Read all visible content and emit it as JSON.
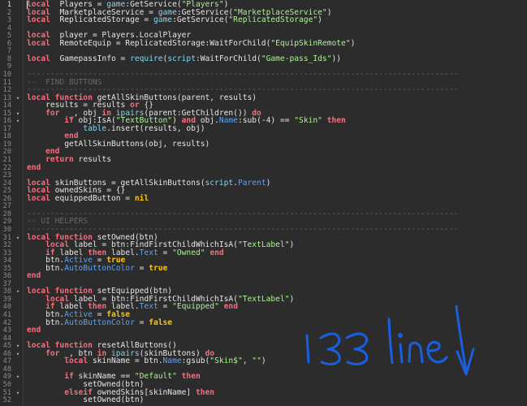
{
  "annotation": {
    "text": "133 line",
    "color": "#1a5fe0"
  },
  "lines": [
    {
      "n": "1",
      "fold": "",
      "spans": [
        [
          "kw",
          "local"
        ],
        [
          "",
          "  Players = "
        ],
        [
          "bi",
          "game"
        ],
        [
          "",
          ":GetService("
        ],
        [
          "str",
          "\"Players\""
        ],
        [
          "",
          ")"
        ]
      ]
    },
    {
      "n": "2",
      "fold": "",
      "spans": [
        [
          "kw",
          "local"
        ],
        [
          "",
          "  MarketplaceService = "
        ],
        [
          "bi",
          "game"
        ],
        [
          "",
          ":GetService("
        ],
        [
          "str",
          "\"MarketplaceService\""
        ],
        [
          "",
          ")"
        ]
      ]
    },
    {
      "n": "3",
      "fold": "",
      "spans": [
        [
          "kw",
          "local"
        ],
        [
          "",
          "  ReplicatedStorage = "
        ],
        [
          "bi",
          "game"
        ],
        [
          "",
          ":GetService("
        ],
        [
          "str",
          "\"ReplicatedStorage\""
        ],
        [
          "",
          ")"
        ]
      ]
    },
    {
      "n": "4",
      "fold": "",
      "spans": []
    },
    {
      "n": "5",
      "fold": "",
      "spans": [
        [
          "kw",
          "local"
        ],
        [
          "",
          "  player = Players.LocalPlayer"
        ]
      ]
    },
    {
      "n": "6",
      "fold": "",
      "spans": [
        [
          "kw",
          "local"
        ],
        [
          "",
          "  RemoteEquip = ReplicatedStorage:WaitForChild("
        ],
        [
          "str",
          "\"EquipSkinRemote\""
        ],
        [
          "",
          ")"
        ]
      ]
    },
    {
      "n": "7",
      "fold": "",
      "spans": []
    },
    {
      "n": "8",
      "fold": "",
      "spans": [
        [
          "kw",
          "local"
        ],
        [
          "",
          "  GamepassInfo = "
        ],
        [
          "bi",
          "require"
        ],
        [
          "",
          "("
        ],
        [
          "bi",
          "script"
        ],
        [
          "",
          ":WaitForChild("
        ],
        [
          "str",
          "\"Game-pass_Ids\""
        ],
        [
          "",
          "))"
        ]
      ]
    },
    {
      "n": "9",
      "fold": "",
      "spans": []
    },
    {
      "n": "10",
      "fold": "",
      "spans": [
        [
          "cm",
          "--------------------------------------------------------------------------------------------"
        ]
      ]
    },
    {
      "n": "11",
      "fold": "",
      "spans": [
        [
          "cm",
          "--  FIND BUTTONS"
        ]
      ]
    },
    {
      "n": "12",
      "fold": "",
      "spans": [
        [
          "cm",
          "--------------------------------------------------------------------------------------------"
        ]
      ]
    },
    {
      "n": "13",
      "fold": "v",
      "spans": [
        [
          "kw",
          "local function"
        ],
        [
          "",
          " getAllSkinButtons(parent, results)"
        ]
      ]
    },
    {
      "n": "14",
      "fold": "",
      "spans": [
        [
          "",
          "    results = results "
        ],
        [
          "kw",
          "or"
        ],
        [
          "",
          " {}"
        ]
      ]
    },
    {
      "n": "15",
      "fold": "v",
      "spans": [
        [
          "",
          "    "
        ],
        [
          "kw",
          "for"
        ],
        [
          "",
          "  _, obj "
        ],
        [
          "kw",
          "in"
        ],
        [
          "",
          " "
        ],
        [
          "bi",
          "ipairs"
        ],
        [
          "",
          "(parent:GetChildren()) "
        ],
        [
          "kw",
          "do"
        ]
      ]
    },
    {
      "n": "16",
      "fold": "v",
      "spans": [
        [
          "",
          "        "
        ],
        [
          "kw",
          "if"
        ],
        [
          "",
          " obj:IsA("
        ],
        [
          "str",
          "\"TextButton\""
        ],
        [
          "",
          ") "
        ],
        [
          "kw",
          "and"
        ],
        [
          "",
          " obj."
        ],
        [
          "prop",
          "Name"
        ],
        [
          "",
          ":sub(-4) == "
        ],
        [
          "str",
          "\"Skin\""
        ],
        [
          "",
          " "
        ],
        [
          "kw",
          "then"
        ]
      ]
    },
    {
      "n": "17",
      "fold": "",
      "spans": [
        [
          "",
          "            "
        ],
        [
          "bi",
          "table"
        ],
        [
          "",
          ".insert(results, obj)"
        ]
      ]
    },
    {
      "n": "18",
      "fold": "",
      "spans": [
        [
          "",
          "        "
        ],
        [
          "kw",
          "end"
        ]
      ]
    },
    {
      "n": "19",
      "fold": "",
      "spans": [
        [
          "",
          "        getAllSkinButtons(obj, results)"
        ]
      ]
    },
    {
      "n": "20",
      "fold": "",
      "spans": [
        [
          "",
          "    "
        ],
        [
          "kw",
          "end"
        ]
      ]
    },
    {
      "n": "21",
      "fold": "",
      "spans": [
        [
          "",
          "    "
        ],
        [
          "kw",
          "return"
        ],
        [
          "",
          " results"
        ]
      ]
    },
    {
      "n": "22",
      "fold": "",
      "spans": [
        [
          "kw",
          "end"
        ]
      ]
    },
    {
      "n": "23",
      "fold": "",
      "spans": []
    },
    {
      "n": "24",
      "fold": "",
      "spans": [
        [
          "kw",
          "local"
        ],
        [
          "",
          " skinButtons = getAllSkinButtons("
        ],
        [
          "bi",
          "script"
        ],
        [
          "",
          "."
        ],
        [
          "prop",
          "Parent"
        ],
        [
          "",
          ")"
        ]
      ]
    },
    {
      "n": "25",
      "fold": "",
      "spans": [
        [
          "kw",
          "local"
        ],
        [
          "",
          " ownedSkins = {}"
        ]
      ]
    },
    {
      "n": "26",
      "fold": "",
      "spans": [
        [
          "kw",
          "local"
        ],
        [
          "",
          " equippedButton = "
        ],
        [
          "lit",
          "nil"
        ]
      ]
    },
    {
      "n": "27",
      "fold": "",
      "spans": []
    },
    {
      "n": "28",
      "fold": "",
      "spans": [
        [
          "cm",
          "--------------------------------------------------------------------------------------------"
        ]
      ]
    },
    {
      "n": "29",
      "fold": "",
      "spans": [
        [
          "cm",
          "-- UI HELPERS"
        ]
      ]
    },
    {
      "n": "30",
      "fold": "",
      "spans": [
        [
          "cm",
          "--------------------------------------------------------------------------------------------"
        ]
      ]
    },
    {
      "n": "31",
      "fold": "v",
      "spans": [
        [
          "kw",
          "local function"
        ],
        [
          "",
          " setOwned(btn)"
        ]
      ]
    },
    {
      "n": "32",
      "fold": "",
      "spans": [
        [
          "",
          "    "
        ],
        [
          "kw",
          "local"
        ],
        [
          "",
          " label = btn:FindFirstChildWhichIsA("
        ],
        [
          "str",
          "\"TextLabel\""
        ],
        [
          "",
          ")"
        ]
      ]
    },
    {
      "n": "33",
      "fold": "",
      "spans": [
        [
          "",
          "    "
        ],
        [
          "kw",
          "if"
        ],
        [
          "",
          " label "
        ],
        [
          "kw",
          "then"
        ],
        [
          "",
          " label."
        ],
        [
          "prop",
          "Text"
        ],
        [
          "",
          " = "
        ],
        [
          "str",
          "\"Owned\""
        ],
        [
          "",
          " "
        ],
        [
          "kw",
          "end"
        ]
      ]
    },
    {
      "n": "34",
      "fold": "",
      "spans": [
        [
          "",
          "    btn."
        ],
        [
          "prop",
          "Active"
        ],
        [
          "",
          " = "
        ],
        [
          "lit",
          "true"
        ]
      ]
    },
    {
      "n": "35",
      "fold": "",
      "spans": [
        [
          "",
          "    btn."
        ],
        [
          "prop",
          "AutoButtonColor"
        ],
        [
          "",
          " = "
        ],
        [
          "lit",
          "true"
        ]
      ]
    },
    {
      "n": "36",
      "fold": "",
      "spans": [
        [
          "kw",
          "end"
        ]
      ]
    },
    {
      "n": "37",
      "fold": "",
      "spans": []
    },
    {
      "n": "38",
      "fold": "v",
      "spans": [
        [
          "kw",
          "local function"
        ],
        [
          "",
          " setEquipped(btn)"
        ]
      ]
    },
    {
      "n": "39",
      "fold": "",
      "spans": [
        [
          "",
          "    "
        ],
        [
          "kw",
          "local"
        ],
        [
          "",
          " label = btn:FindFirstChildWhichIsA("
        ],
        [
          "str",
          "\"TextLabel\""
        ],
        [
          "",
          ")"
        ]
      ]
    },
    {
      "n": "40",
      "fold": "",
      "spans": [
        [
          "",
          "    "
        ],
        [
          "kw",
          "if"
        ],
        [
          "",
          " label "
        ],
        [
          "kw",
          "then"
        ],
        [
          "",
          " label."
        ],
        [
          "prop",
          "Text"
        ],
        [
          "",
          " = "
        ],
        [
          "str",
          "\"Equipped\""
        ],
        [
          "",
          " "
        ],
        [
          "kw",
          "end"
        ]
      ]
    },
    {
      "n": "41",
      "fold": "",
      "spans": [
        [
          "",
          "    btn."
        ],
        [
          "prop",
          "Active"
        ],
        [
          "",
          " = "
        ],
        [
          "lit",
          "false"
        ]
      ]
    },
    {
      "n": "42",
      "fold": "",
      "spans": [
        [
          "",
          "    btn."
        ],
        [
          "prop",
          "AutoButtonColor"
        ],
        [
          "",
          " = "
        ],
        [
          "lit",
          "false"
        ]
      ]
    },
    {
      "n": "43",
      "fold": "",
      "spans": [
        [
          "kw",
          "end"
        ]
      ]
    },
    {
      "n": "44",
      "fold": "",
      "spans": []
    },
    {
      "n": "45",
      "fold": "v",
      "spans": [
        [
          "kw",
          "local function"
        ],
        [
          "",
          " resetAllButtons()"
        ]
      ]
    },
    {
      "n": "46",
      "fold": "v",
      "spans": [
        [
          "",
          "    "
        ],
        [
          "kw",
          "for"
        ],
        [
          "",
          " _, btn "
        ],
        [
          "kw",
          "in"
        ],
        [
          "",
          " "
        ],
        [
          "bi",
          "ipairs"
        ],
        [
          "",
          "(skinButtons) "
        ],
        [
          "kw",
          "do"
        ]
      ]
    },
    {
      "n": "47",
      "fold": "",
      "spans": [
        [
          "",
          "        "
        ],
        [
          "kw",
          "local"
        ],
        [
          "",
          " skinName = btn."
        ],
        [
          "prop",
          "Name"
        ],
        [
          "",
          ":gsub("
        ],
        [
          "str",
          "\"Skin$\""
        ],
        [
          "",
          ", "
        ],
        [
          "str",
          "\"\""
        ],
        [
          "",
          ")"
        ]
      ]
    },
    {
      "n": "48",
      "fold": "",
      "spans": []
    },
    {
      "n": "49",
      "fold": "v",
      "spans": [
        [
          "",
          "        "
        ],
        [
          "kw",
          "if"
        ],
        [
          "",
          " skinName == "
        ],
        [
          "str",
          "\"Default\""
        ],
        [
          "",
          " "
        ],
        [
          "kw",
          "then"
        ]
      ]
    },
    {
      "n": "50",
      "fold": "",
      "spans": [
        [
          "",
          "            setOwned(btn)"
        ]
      ]
    },
    {
      "n": "51",
      "fold": "v",
      "spans": [
        [
          "",
          "        "
        ],
        [
          "kw",
          "elseif"
        ],
        [
          "",
          " ownedSkins[skinName] "
        ],
        [
          "kw",
          "then"
        ]
      ]
    },
    {
      "n": "52",
      "fold": "",
      "spans": [
        [
          "",
          "            setOwned(btn)"
        ]
      ]
    }
  ]
}
